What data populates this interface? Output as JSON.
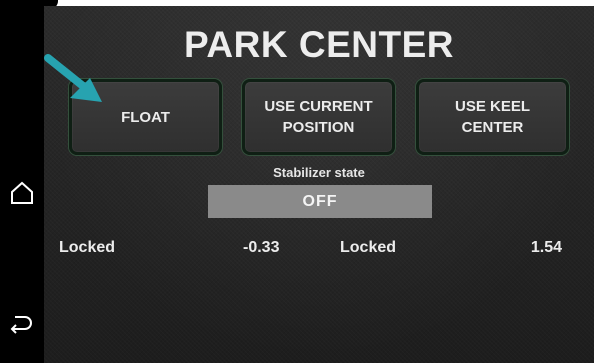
{
  "title": "PARK CENTER",
  "buttons": {
    "float": "FLOAT",
    "use_current_position": "USE CURRENT\nPOSITION",
    "use_keel_center": "USE KEEL\nCENTER"
  },
  "stabilizer": {
    "label": "Stabilizer state",
    "value": "OFF"
  },
  "readings": [
    {
      "label": "Locked",
      "value": "-0.33"
    },
    {
      "label": "Locked",
      "value": "1.54"
    }
  ],
  "sidebar": {
    "icons": [
      "home-icon",
      "back-icon"
    ]
  },
  "colors": {
    "arrow": "#27a3b0",
    "state_box": "#8a8a8a",
    "button_border": "#34503c"
  }
}
